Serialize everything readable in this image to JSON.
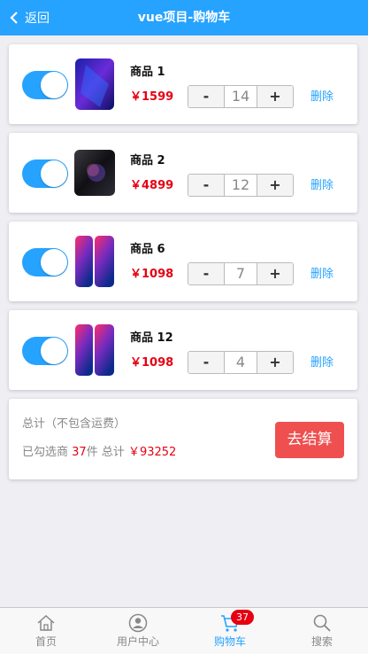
{
  "header": {
    "back_label": "返回",
    "title": "vue项目-购物车"
  },
  "accent_color": "#26a2ff",
  "price_color": "#e60012",
  "cart": {
    "items": [
      {
        "name": "商品 1",
        "price": "￥1599",
        "qty": "14",
        "selected": true,
        "delete_label": "删除",
        "thumb": "phone-purple"
      },
      {
        "name": "商品 2",
        "price": "￥4899",
        "qty": "12",
        "selected": true,
        "delete_label": "删除",
        "thumb": "phone-black"
      },
      {
        "name": "商品 6",
        "price": "￥1098",
        "qty": "7",
        "selected": true,
        "delete_label": "删除",
        "thumb": "phone-pink-blue"
      },
      {
        "name": "商品 12",
        "price": "￥1098",
        "qty": "4",
        "selected": true,
        "delete_label": "删除",
        "thumb": "phone-pink-blue"
      }
    ],
    "minus_label": "-",
    "plus_label": "+"
  },
  "summary": {
    "label": "总计（不包含运费）",
    "selected_prefix": "已勾选商",
    "selected_count": "37",
    "selected_unit": "件 总计 ",
    "total": "￥93252",
    "checkout_label": "去结算"
  },
  "tabbar": {
    "tabs": [
      {
        "label": "首页",
        "icon": "home-icon"
      },
      {
        "label": "用户中心",
        "icon": "user-icon"
      },
      {
        "label": "购物车",
        "icon": "cart-icon",
        "active": true
      },
      {
        "label": "搜索",
        "icon": "search-icon"
      }
    ],
    "cart_badge": "37"
  }
}
